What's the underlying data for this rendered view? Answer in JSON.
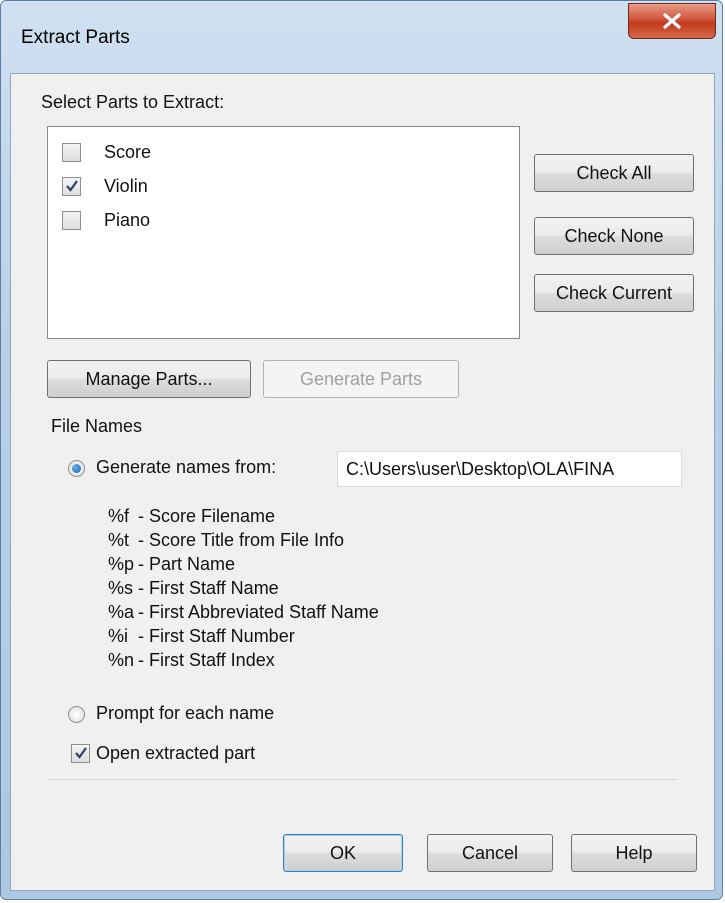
{
  "window": {
    "title": "Extract Parts"
  },
  "parts_section": {
    "label": "Select Parts to Extract:"
  },
  "parts": [
    {
      "label": "Score",
      "checked": false
    },
    {
      "label": "Violin",
      "checked": true
    },
    {
      "label": "Piano",
      "checked": false
    }
  ],
  "buttons": {
    "check_all": "Check All",
    "check_none": "Check None",
    "check_current": "Check Current",
    "manage_parts": "Manage Parts...",
    "generate_parts": "Generate Parts",
    "ok": "OK",
    "cancel": "Cancel",
    "help": "Help"
  },
  "file_names": {
    "group_label": "File Names",
    "generate_label": "Generate names from:",
    "generate_selected": true,
    "path_value": "C:\\Users\\user\\Desktop\\OLA\\FINA",
    "codes": [
      {
        "code": "%f",
        "desc": "- Score Filename"
      },
      {
        "code": "%t",
        "desc": "- Score Title from File Info"
      },
      {
        "code": "%p",
        "desc": "- Part Name"
      },
      {
        "code": "%s",
        "desc": "- First Staff Name"
      },
      {
        "code": "%a",
        "desc": "- First Abbreviated Staff Name"
      },
      {
        "code": "%i",
        "desc": "- First Staff Number"
      },
      {
        "code": "%n",
        "desc": "- First Staff Index"
      }
    ],
    "prompt_label": "Prompt for each name",
    "prompt_selected": false,
    "open_label": "Open extracted part",
    "open_checked": true
  },
  "colors": {
    "frame": "#b8cfe6",
    "close_button": "#c23a1e",
    "dialog_bg": "#f0f0f0",
    "default_button_border": "#3c7fb1"
  },
  "icons": {
    "close": "close-icon",
    "check": "checkmark-icon",
    "radio": "radio-dot"
  }
}
